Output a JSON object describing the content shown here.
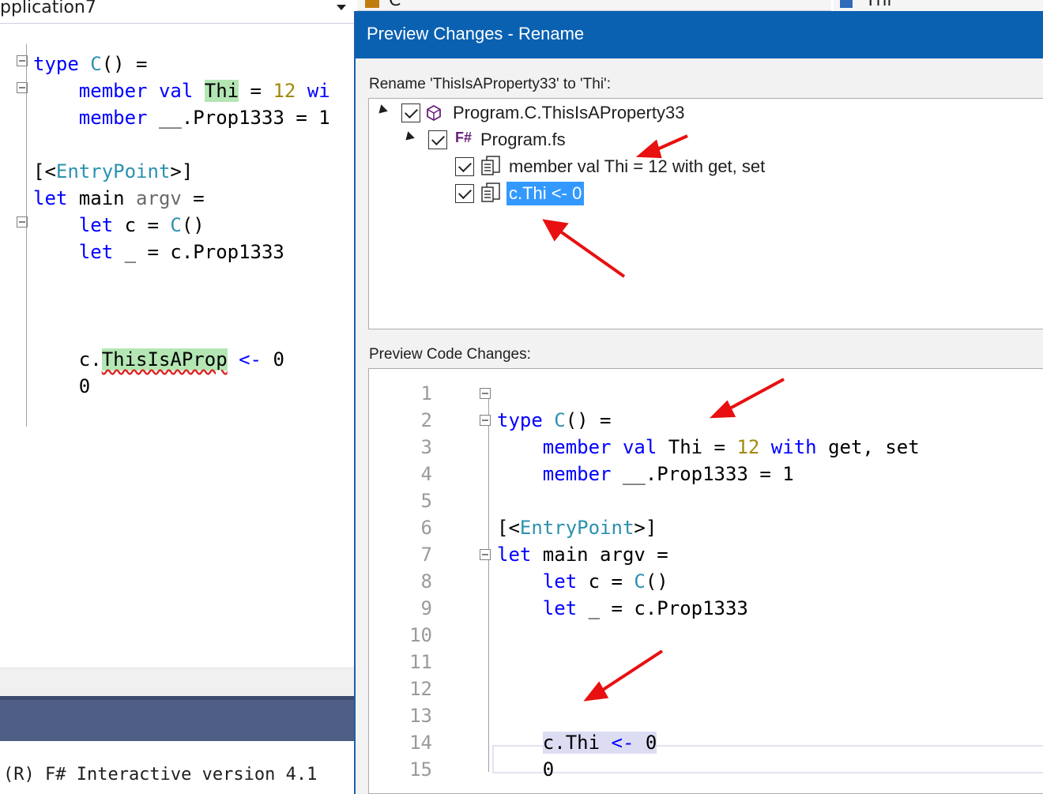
{
  "background_editor": {
    "project_name": "pplication7",
    "code_lines": [
      {
        "segments": [
          {
            "t": "type ",
            "c": "kw"
          },
          {
            "t": "C",
            "c": "ty"
          },
          {
            "t": "() =",
            "c": ""
          }
        ]
      },
      {
        "segments": [
          {
            "t": "    member val ",
            "c": "kw"
          },
          {
            "t": "Thi",
            "c": "hlgreen"
          },
          {
            "t": " = ",
            "c": ""
          },
          {
            "t": "12",
            "c": "num"
          },
          {
            "t": " wi",
            "c": "kw"
          }
        ]
      },
      {
        "segments": [
          {
            "t": "    member ",
            "c": "kw"
          },
          {
            "t": "__.Prop1333 = 1",
            "c": ""
          }
        ]
      },
      {
        "segments": [
          {
            "t": "",
            "c": ""
          }
        ]
      },
      {
        "segments": [
          {
            "t": "[<",
            "c": ""
          },
          {
            "t": "EntryPoint",
            "c": "ty"
          },
          {
            "t": ">]",
            "c": ""
          }
        ]
      },
      {
        "segments": [
          {
            "t": "let ",
            "c": "kw"
          },
          {
            "t": "main ",
            "c": ""
          },
          {
            "t": "argv",
            "c": "dim"
          },
          {
            "t": " =",
            "c": ""
          }
        ]
      },
      {
        "segments": [
          {
            "t": "    let ",
            "c": "kw"
          },
          {
            "t": "c = ",
            "c": ""
          },
          {
            "t": "C",
            "c": "ty"
          },
          {
            "t": "()",
            "c": ""
          }
        ]
      },
      {
        "segments": [
          {
            "t": "    let ",
            "c": "kw"
          },
          {
            "t": "_ = c.Prop1333",
            "c": ""
          }
        ]
      },
      {
        "segments": [
          {
            "t": "",
            "c": ""
          }
        ]
      },
      {
        "segments": [
          {
            "t": "",
            "c": ""
          }
        ]
      },
      {
        "segments": [
          {
            "t": "",
            "c": ""
          }
        ]
      },
      {
        "segments": [
          {
            "t": "    c.",
            "c": ""
          },
          {
            "t": "ThisIsAProp",
            "c": "hlerr"
          },
          {
            "t": " <- ",
            "c": "kw"
          },
          {
            "t": "0",
            "c": ""
          }
        ]
      },
      {
        "segments": [
          {
            "t": "    0",
            "c": ""
          }
        ]
      }
    ],
    "interactive_text": "(R) F# Interactive version 4.1"
  },
  "navbar": {
    "type_dropdown": "C",
    "member_dropdown": "Thi"
  },
  "dialog": {
    "title": "Preview Changes - Rename",
    "rename_label": "Rename 'ThisIsAProperty33' to 'Thi':",
    "tree": {
      "root": {
        "label": "Program.C.ThisIsAProperty33",
        "checked": true,
        "expanded": true
      },
      "file": {
        "label": "Program.fs",
        "icon_text": "F#",
        "checked": true,
        "expanded": true
      },
      "changes": [
        {
          "label": "member val Thi = 12 with get, set",
          "checked": true,
          "selected": false
        },
        {
          "label": "c.Thi <- 0",
          "checked": true,
          "selected": true
        }
      ]
    },
    "preview_label": "Preview Code Changes:",
    "preview_lines": [
      {
        "n": "1",
        "segments": []
      },
      {
        "n": "2",
        "segments": [
          {
            "t": "type ",
            "c": "kw"
          },
          {
            "t": "C",
            "c": "ty"
          },
          {
            "t": "() =",
            "c": ""
          }
        ]
      },
      {
        "n": "3",
        "segments": [
          {
            "t": "    member val ",
            "c": "kw"
          },
          {
            "t": "Thi = ",
            "c": ""
          },
          {
            "t": "12",
            "c": "num"
          },
          {
            "t": " with ",
            "c": "kw"
          },
          {
            "t": "get, set",
            "c": ""
          }
        ]
      },
      {
        "n": "4",
        "segments": [
          {
            "t": "    member ",
            "c": "kw"
          },
          {
            "t": "__.Prop1333 = 1",
            "c": ""
          }
        ]
      },
      {
        "n": "5",
        "segments": []
      },
      {
        "n": "6",
        "segments": [
          {
            "t": "[<",
            "c": ""
          },
          {
            "t": "EntryPoint",
            "c": "ty"
          },
          {
            "t": ">]",
            "c": ""
          }
        ]
      },
      {
        "n": "7",
        "segments": [
          {
            "t": "let ",
            "c": "kw"
          },
          {
            "t": "main argv =",
            "c": ""
          }
        ]
      },
      {
        "n": "8",
        "segments": [
          {
            "t": "    let ",
            "c": "kw"
          },
          {
            "t": "c = ",
            "c": ""
          },
          {
            "t": "C",
            "c": "ty"
          },
          {
            "t": "()",
            "c": ""
          }
        ]
      },
      {
        "n": "9",
        "segments": [
          {
            "t": "    let ",
            "c": "kw"
          },
          {
            "t": "_ = c.Prop1333",
            "c": ""
          }
        ]
      },
      {
        "n": "10",
        "segments": []
      },
      {
        "n": "11",
        "segments": []
      },
      {
        "n": "12",
        "segments": []
      },
      {
        "n": "13",
        "segments": []
      },
      {
        "n": "14",
        "segments": [
          {
            "t": "    ",
            "c": ""
          },
          {
            "t": "c.Thi ",
            "c": "hl"
          },
          {
            "t": "<-",
            "c": "hlkw"
          },
          {
            "t": " 0",
            "c": "hl"
          }
        ]
      },
      {
        "n": "15",
        "segments": [
          {
            "t": "    0",
            "c": ""
          }
        ]
      }
    ]
  },
  "colors": {
    "title_bar": "#0a61b2",
    "selection": "#3399ff",
    "keyword": "#0000ff",
    "type": "#2b91af",
    "number": "#a28a0a",
    "annotation_arrow": "#e81010"
  }
}
